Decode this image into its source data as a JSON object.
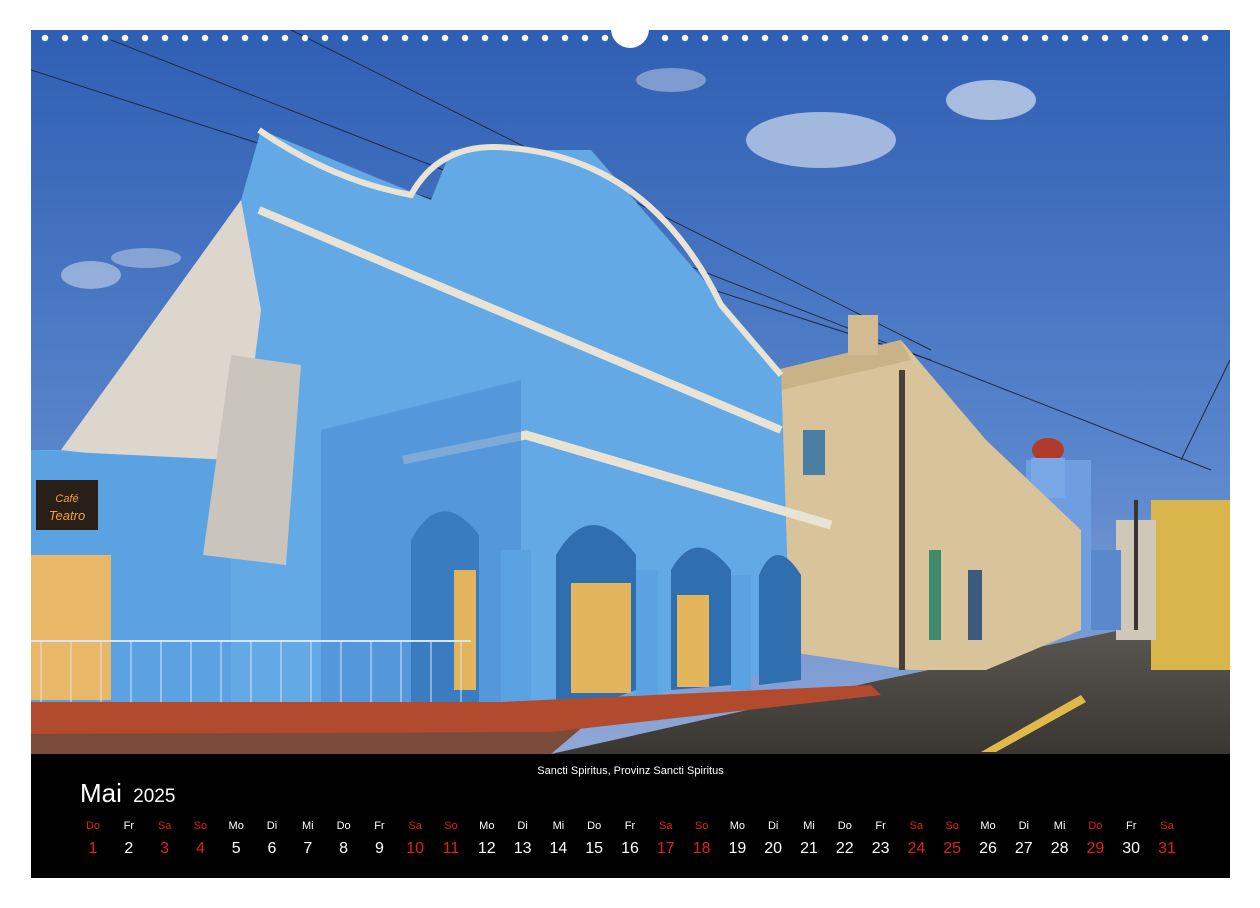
{
  "caption": "Sancti Spiritus, Provinz Sancti Spiritus",
  "month": {
    "name": "Mai",
    "year": "2025"
  },
  "days": [
    {
      "dow": "Do",
      "num": "1",
      "red": true
    },
    {
      "dow": "Fr",
      "num": "2",
      "red": false
    },
    {
      "dow": "Sa",
      "num": "3",
      "red": true
    },
    {
      "dow": "So",
      "num": "4",
      "red": true
    },
    {
      "dow": "Mo",
      "num": "5",
      "red": false
    },
    {
      "dow": "Di",
      "num": "6",
      "red": false
    },
    {
      "dow": "Mi",
      "num": "7",
      "red": false
    },
    {
      "dow": "Do",
      "num": "8",
      "red": false
    },
    {
      "dow": "Fr",
      "num": "9",
      "red": false
    },
    {
      "dow": "Sa",
      "num": "10",
      "red": true
    },
    {
      "dow": "So",
      "num": "11",
      "red": true
    },
    {
      "dow": "Mo",
      "num": "12",
      "red": false
    },
    {
      "dow": "Di",
      "num": "13",
      "red": false
    },
    {
      "dow": "Mi",
      "num": "14",
      "red": false
    },
    {
      "dow": "Do",
      "num": "15",
      "red": false
    },
    {
      "dow": "Fr",
      "num": "16",
      "red": false
    },
    {
      "dow": "Sa",
      "num": "17",
      "red": true
    },
    {
      "dow": "So",
      "num": "18",
      "red": true
    },
    {
      "dow": "Mo",
      "num": "19",
      "red": false
    },
    {
      "dow": "Di",
      "num": "20",
      "red": false
    },
    {
      "dow": "Mi",
      "num": "21",
      "red": false
    },
    {
      "dow": "Do",
      "num": "22",
      "red": false
    },
    {
      "dow": "Fr",
      "num": "23",
      "red": false
    },
    {
      "dow": "Sa",
      "num": "24",
      "red": true
    },
    {
      "dow": "So",
      "num": "25",
      "red": true
    },
    {
      "dow": "Mo",
      "num": "26",
      "red": false
    },
    {
      "dow": "Di",
      "num": "27",
      "red": false
    },
    {
      "dow": "Mi",
      "num": "28",
      "red": false
    },
    {
      "dow": "Do",
      "num": "29",
      "red": true
    },
    {
      "dow": "Fr",
      "num": "30",
      "red": false
    },
    {
      "dow": "Sa",
      "num": "31",
      "red": true
    }
  ],
  "photo": {
    "sign_text": "Café Teatro"
  },
  "colors": {
    "weekend": "#e02020",
    "text": "#ffffff",
    "background": "#000000",
    "facade": "#62a9e6",
    "sky": "#4d7bc4"
  }
}
